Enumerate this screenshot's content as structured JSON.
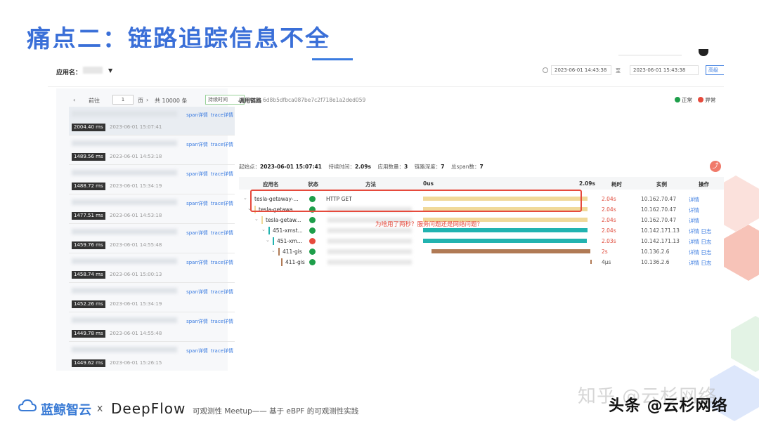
{
  "slide": {
    "title": "痛点二：链路追踪信息不全"
  },
  "topbar": {
    "app_label": "应用名：",
    "time_start": "2023-06-01 14:43:38",
    "time_sep": "至",
    "time_end": "2023-06-01 15:43:38",
    "advanced": "高级"
  },
  "pager": {
    "prev": "前往",
    "page": "1",
    "page_suffix": "页",
    "total": "共 10000 条",
    "sort": "持续时间"
  },
  "list": [
    {
      "duration": "2004.40 ms",
      "time": "2023-06-01 15:07:41",
      "span": "span详情",
      "trace": "trace详情"
    },
    {
      "duration": "1489.56 ms",
      "time": "2023-06-01 14:53:18",
      "span": "span详情",
      "trace": "trace详情"
    },
    {
      "duration": "1488.72 ms",
      "time": "2023-06-01 15:34:19",
      "span": "span详情",
      "trace": "trace详情"
    },
    {
      "duration": "1477.51 ms",
      "time": "2023-06-01 14:53:18",
      "span": "span详情",
      "trace": "trace详情"
    },
    {
      "duration": "1459.76 ms",
      "time": "2023-06-01 14:55:48",
      "span": "span详情",
      "trace": "trace详情"
    },
    {
      "duration": "1458.74 ms",
      "time": "2023-06-01 15:00:13",
      "span": "span详情",
      "trace": "trace详情"
    },
    {
      "duration": "1452.26 ms",
      "time": "2023-06-01 15:34:19",
      "span": "span详情",
      "trace": "trace详情"
    },
    {
      "duration": "1449.78 ms",
      "time": "2023-06-01 14:55:48",
      "span": "span详情",
      "trace": "trace详情"
    },
    {
      "duration": "1449.62 ms",
      "time": "2023-06-01 15:26:15",
      "span": "span详情",
      "trace": "trace详情"
    }
  ],
  "detail": {
    "trace_label": "调用链路",
    "trace_id": "6d8b5dfbca087be7c2f718e1a2ded059",
    "legend_normal": "正常",
    "legend_error": "异常",
    "start_label": "起始点：",
    "start_value": "2023-06-01 15:07:41",
    "duration_label": "持续时间：",
    "duration_value": "2.09s",
    "apps_label": "应用数量：",
    "apps_value": "3",
    "depth_label": "链路深度：",
    "depth_value": "7",
    "spans_label": "总span数：",
    "spans_value": "7"
  },
  "table": {
    "headers": {
      "app": "应用名",
      "status": "状态",
      "method": "方法",
      "start": "0us",
      "end": "2.09s",
      "dur": "耗时",
      "inst": "实例",
      "ops": "操作"
    },
    "rows": [
      {
        "app": "tesla-getaway-...",
        "method": "HTTP GET",
        "dur": "2.04s",
        "inst": "10.162.70.47",
        "ops": "详情"
      },
      {
        "app": "tesla-getawa...",
        "method": "",
        "dur": "2.04s",
        "inst": "10.162.70.47",
        "ops": "详情"
      },
      {
        "app": "tesla-getaw...",
        "method": "",
        "dur": "2.04s",
        "inst": "10.162.70.47",
        "ops": "详情"
      },
      {
        "app": "451-xmst...",
        "method": "",
        "dur": "2.04s",
        "inst": "10.142.171.13",
        "ops": "详情 日志"
      },
      {
        "app": "451-xm...",
        "method": "",
        "dur": "2.03s",
        "inst": "10.142.171.13",
        "ops": "详情 日志"
      },
      {
        "app": "411-gis",
        "method": "",
        "dur": "2s",
        "inst": "10.136.2.6",
        "ops": "详情 日志"
      },
      {
        "app": "411-gis",
        "method": "",
        "dur": "4μs",
        "inst": "10.136.2.6",
        "ops": "详情 日志"
      }
    ]
  },
  "annotation": "为啥用了两秒？服务问题还是网络问题？",
  "footer": {
    "brand": "蓝鲸智云",
    "x": "x",
    "deepflow": "DeepFlow",
    "subtitle": "可观测性 Meetup—— 基于 eBPF 的可观测性实践",
    "watermark_light": "知乎 @云杉网络",
    "watermark_dark": "头条 @云杉网络"
  },
  "colors": {
    "accent": "#3a7be0",
    "normal": "#1e9e4a",
    "error": "#e64a3c",
    "bar_yellow": "#f0d99a",
    "bar_teal": "#22b3b0",
    "bar_brown": "#b07a55"
  }
}
